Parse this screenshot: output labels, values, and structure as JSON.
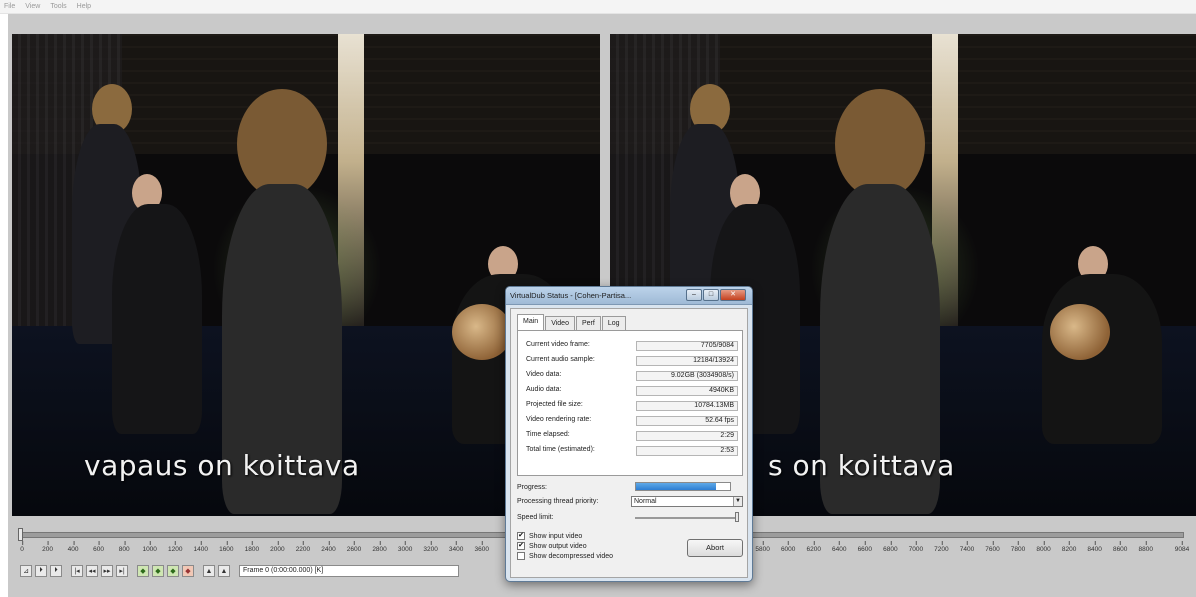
{
  "menu": {
    "file": "File",
    "view": "View",
    "tools": "Tools",
    "help": "Help"
  },
  "video": {
    "input_subtitle": "vapaus on koittava",
    "output_subtitle": "s on koittava"
  },
  "timeline": {
    "ticks": [
      "0",
      "200",
      "400",
      "600",
      "800",
      "1000",
      "1200",
      "1400",
      "1600",
      "1800",
      "2000",
      "2200",
      "2400",
      "2600",
      "2800",
      "3000",
      "3200",
      "3400",
      "3600",
      "5800",
      "6000",
      "6200",
      "6400",
      "6600",
      "6800",
      "7000",
      "7200",
      "7400",
      "7600",
      "7800",
      "8000",
      "8200",
      "8400",
      "8600",
      "8800",
      "9084"
    ],
    "frame_label": "Frame 0 (0:00:00.000) [K]",
    "current_fraction": 0
  },
  "toolbar": {
    "buttons": [
      "⊿",
      "⏵",
      "⏵",
      "|◂",
      "◂◂",
      "▸▸",
      "▸|",
      "◆",
      "◆",
      "◆",
      "◆",
      "▲",
      "▲"
    ]
  },
  "dialog": {
    "title": "VirtualDub Status - [Cohen-Partisa...",
    "tabs": [
      "Main",
      "Video",
      "Perf",
      "Log"
    ],
    "active_tab": "Main",
    "stats": [
      {
        "label": "Current video frame:",
        "value": "7705/9084"
      },
      {
        "label": "Current audio sample:",
        "value": "12184/13924"
      },
      {
        "label": "Video data:",
        "value": "9.02GB (3034908/s)"
      },
      {
        "label": "Audio data:",
        "value": "4940KB"
      },
      {
        "label": "Projected file size:",
        "value": "10784.13MB"
      },
      {
        "label": "Video rendering rate:",
        "value": "52.64 fps"
      },
      {
        "label": "Time elapsed:",
        "value": "2:29"
      },
      {
        "label": "Total time (estimated):",
        "value": "2:53"
      }
    ],
    "progress_label": "Progress:",
    "progress_fraction": 0.85,
    "priority_label": "Processing thread priority:",
    "priority_value": "Normal",
    "speed_label": "Speed limit:",
    "speed_fraction": 1.0,
    "checkboxes": [
      {
        "label": "Show input video",
        "checked": true
      },
      {
        "label": "Show output video",
        "checked": true
      },
      {
        "label": "Show decompressed video",
        "checked": false
      }
    ],
    "abort_label": "Abort"
  }
}
